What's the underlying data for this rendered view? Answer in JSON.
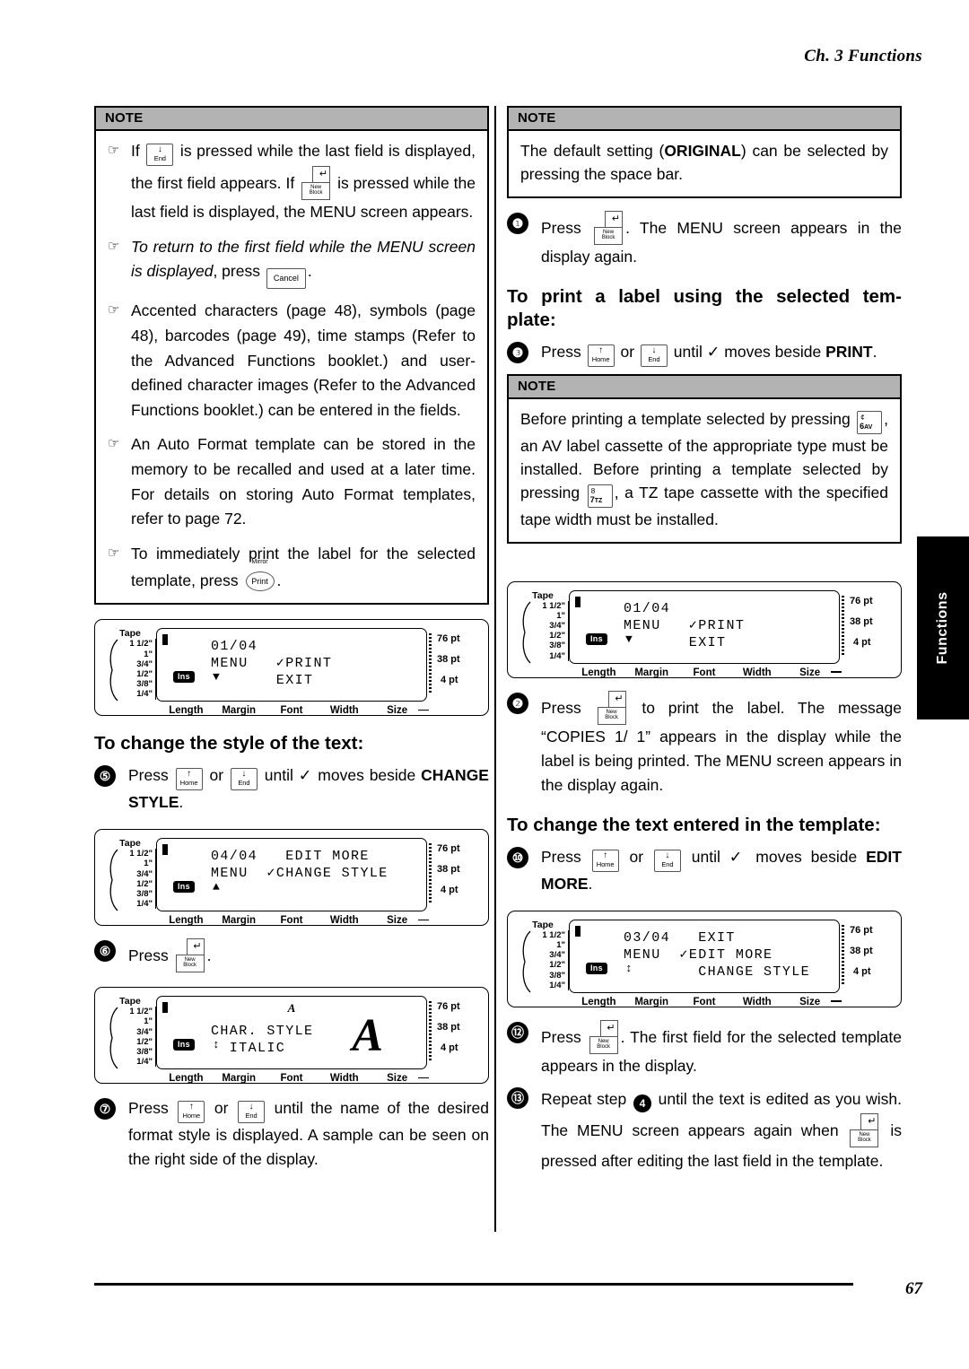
{
  "header": {
    "chapter": "Ch. 3 Functions"
  },
  "footer": {
    "page_number": "67"
  },
  "side_tab": {
    "label": "Functions"
  },
  "keys": {
    "home": {
      "arrow": "↑",
      "label": "Home"
    },
    "end": {
      "arrow": "↓",
      "label": "End"
    },
    "newblock": {
      "arrow": "↵",
      "line1": "New",
      "line2": "Block"
    },
    "cancel": {
      "label": "Cancel"
    },
    "print": {
      "top_label": "Mirror",
      "label": "Print"
    },
    "key6av": {
      "top": "¢",
      "bottom": "6",
      "sub": "AV"
    },
    "key7tz": {
      "top": "8",
      "bottom": "7",
      "sub": "TZ"
    }
  },
  "left_note": {
    "title": "NOTE",
    "items": [
      {
        "pre": "If ",
        "key": "end",
        "post": " is pressed while the last field is displayed, the first field appears. If ",
        "key2": "newblock",
        "post2": " is pressed while the last field is displayed, the MENU screen appears."
      },
      {
        "italic_pre": "To return to the first field while the MENU screen is displayed",
        "mid": ", press ",
        "key": "cancel",
        "post": "."
      },
      {
        "text": "Accented characters (page 48), symbols (page 48), barcodes (page 49), time stamps (Refer to the Advanced Functions booklet.) and user-defined character images (Refer to the Advanced Functions booklet.) can be entered in the fields."
      },
      {
        "text": "An Auto Format template can be stored in the memory to be recalled and used at a later time. For details on storing Auto Format templates, refer to page 72."
      },
      {
        "pre": "To immediately print the label for the selected template, press ",
        "key": "print",
        "post": "."
      }
    ]
  },
  "right_note_1": {
    "title": "NOTE",
    "text_a": "The default setting (",
    "bold": "ORIGINAL",
    "text_b": ") can be selected by pressing the space bar."
  },
  "right_note_2": {
    "title": "NOTE",
    "text_a": "Before printing a template selected by pressing ",
    "text_b": ", an AV label cassette of the appropriate type must be installed. Before printing a template selected by pressing ",
    "text_c": ", a TZ tape cassette with the specified tape width must be installed."
  },
  "steps": {
    "s8": {
      "num": "❶",
      "pre": "Press ",
      "post": ". The MENU screen appears in the display again."
    },
    "s9": {
      "num": "❸",
      "pre": "Press ",
      "mid": " or ",
      "mid2": " until ✓ moves beside ",
      "bold": "PRINT",
      "post": "."
    },
    "s10": {
      "num": "❷",
      "pre": "Press ",
      "post": " to print the label. The message “COPIES 1/ 1” appears in the display while the label is being printed. The MENU screen appears in the display again."
    },
    "s11": {
      "num": "⑩",
      "pre": "Press ",
      "mid": " or ",
      "mid2": " until ✓ moves beside ",
      "bold": "EDIT MORE",
      "post": "."
    },
    "s12": {
      "num": "⑫",
      "pre": "Press ",
      "post": ". The first field for the selected template appears in the display."
    },
    "s13": {
      "num": "⑬",
      "pre": "Repeat step ",
      "inline_num": "4",
      "mid": " until the text is edited as you wish. The MENU screen appears again when ",
      "post": " is pressed after editing the last field in the template."
    },
    "s5": {
      "num": "⑤",
      "pre": "Press ",
      "mid": " or ",
      "mid2": " until ✓ moves beside ",
      "bold": "CHANGE STYLE",
      "post": "."
    },
    "s6": {
      "num": "⑥",
      "pre": "Press ",
      "post": "."
    },
    "s7": {
      "num": "⑦",
      "pre": "Press ",
      "mid": " or ",
      "mid2": " until the name of the desired format style is displayed. A sample can be seen on the right side of the display."
    }
  },
  "headings": {
    "print_template": "To print a label using the selected tem-\nplate:",
    "change_style": "To change the style of the text:",
    "change_text": "To change the text entered in the template:"
  },
  "lcd_common": {
    "tape_title": "Tape",
    "tape_values": [
      "1 1/2\"",
      "1\"",
      "3/4\"",
      "1/2\"",
      "3/8\"",
      "1/4\""
    ],
    "pt_values": [
      "76 pt",
      "38 pt",
      "4 pt"
    ],
    "bottom_labels": [
      "Length",
      "Margin",
      "Font",
      "Width",
      "Size"
    ],
    "ins_badge": "Ins"
  },
  "lcd_screens": {
    "menu_print_left": {
      "line1": "01/04",
      "line2": "MENU   ✓PRINT",
      "line3": "       EXIT",
      "arrow": "▼"
    },
    "menu_print_right": {
      "line1": "01/04",
      "line2": "MENU   ✓PRINT",
      "line3": "       EXIT",
      "arrow": "▼"
    },
    "change_style": {
      "line1": "04/04   EDIT MORE",
      "line2": "MENU  ✓CHANGE STYLE",
      "line3": "",
      "arrow": "▲"
    },
    "edit_more": {
      "line1": "03/04   EXIT",
      "line2": "MENU  ✓EDIT MORE",
      "line3": "        CHANGE STYLE",
      "arrow": "↕"
    },
    "char_style": {
      "line1": "",
      "line2": "CHAR. STYLE",
      "line3": "  ITALIC",
      "arrow": "↕",
      "sample_small": "A",
      "sample_big": "A"
    }
  }
}
